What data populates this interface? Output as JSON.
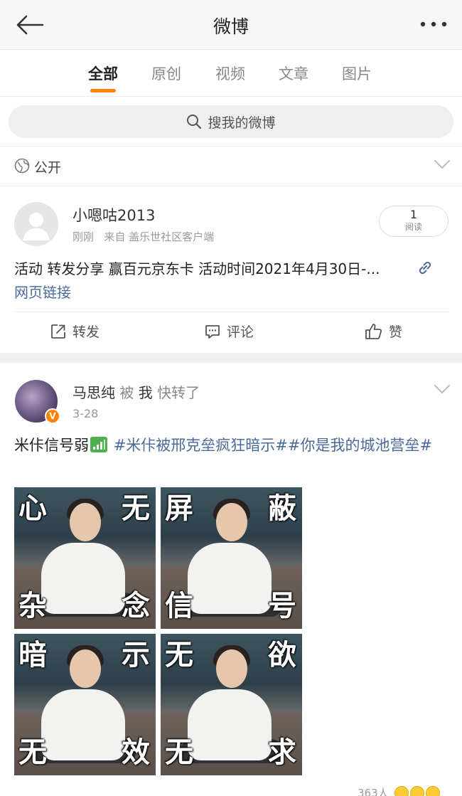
{
  "header": {
    "title": "微博"
  },
  "tabs": [
    {
      "label": "全部",
      "active": true
    },
    {
      "label": "原创",
      "active": false
    },
    {
      "label": "视频",
      "active": false
    },
    {
      "label": "文章",
      "active": false
    },
    {
      "label": "图片",
      "active": false
    }
  ],
  "search": {
    "placeholder": "搜我的微博"
  },
  "privacy": {
    "label": "公开"
  },
  "post1": {
    "username": "小嗯咕2013",
    "time": "刚刚",
    "source": "来自 盖乐世社区客户端",
    "read_count": "1",
    "read_label": "阅读",
    "text": "活动 转发分享 赢百元京东卡 活动时间2021年4月30日-...",
    "link_label": "网页链接",
    "actions": {
      "repost": "转发",
      "comment": "评论",
      "like": "赞"
    }
  },
  "post2": {
    "author": "马思纯",
    "by_word": "被",
    "me_word": "我",
    "forwarded": "快转了",
    "verified_mark": "V",
    "date": "3-28",
    "text_prefix": "米佧信号弱",
    "hashtag1": "#米佧被邢克垒疯狂暗示#",
    "hashtag2": "#你是我的城池营垒#",
    "images": [
      {
        "captions": [
          "心",
          "无",
          "杂",
          "念"
        ]
      },
      {
        "captions": [
          "屏",
          "蔽",
          "信",
          "号"
        ]
      },
      {
        "captions": [
          "暗",
          "示",
          "无",
          "效"
        ]
      },
      {
        "captions": [
          "无",
          "欲",
          "无",
          "求"
        ]
      }
    ],
    "likes_text": "363人"
  },
  "colors": {
    "accent": "#ff8200",
    "link": "#4a6a9a",
    "verified": "#ff8200"
  }
}
